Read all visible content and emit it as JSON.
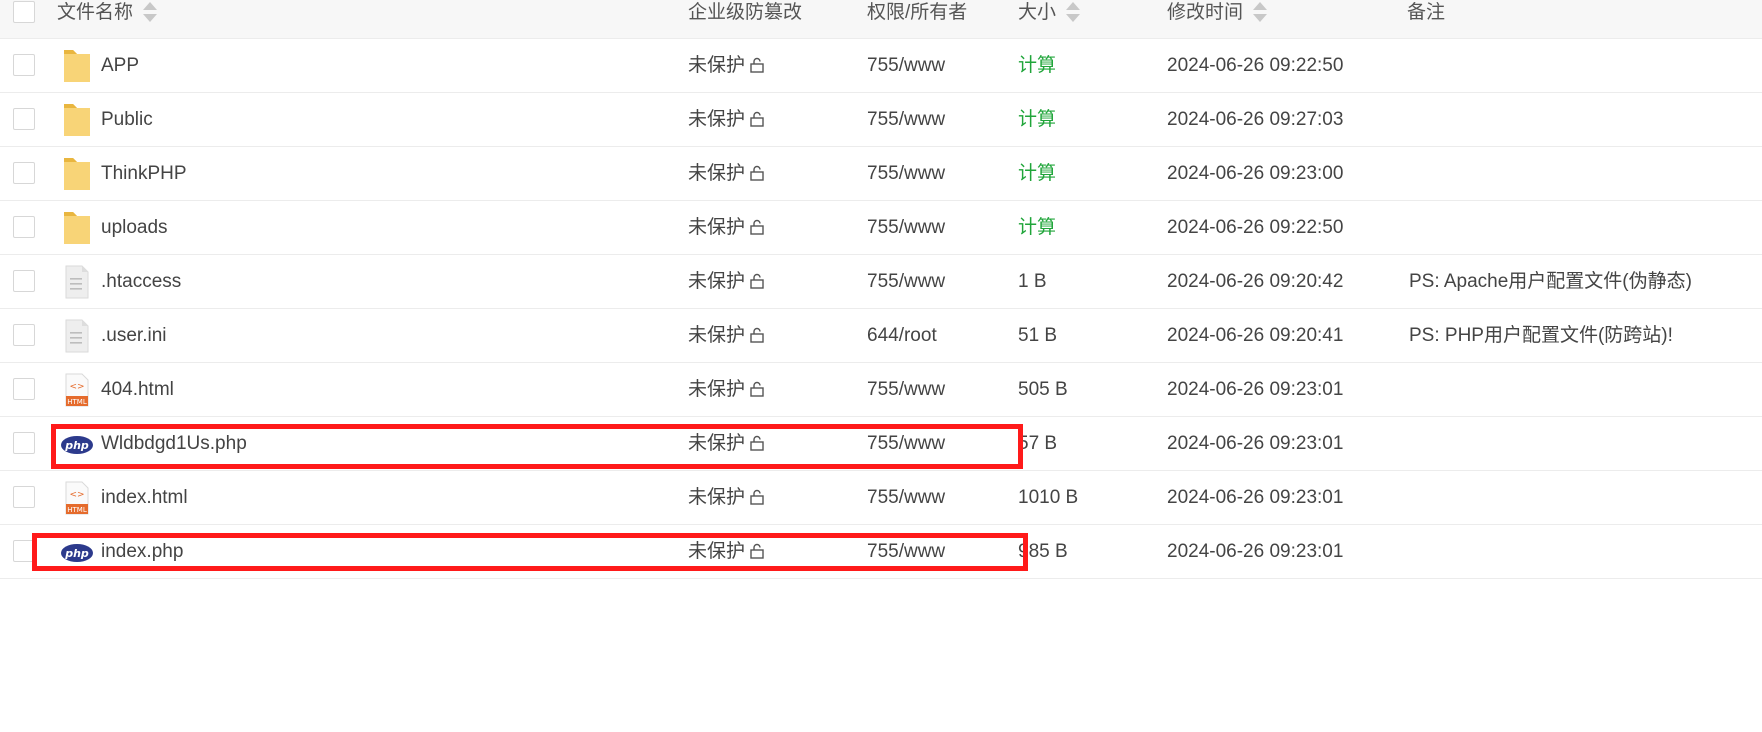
{
  "header": {
    "filename": "文件名称",
    "protection": "企业级防篡改",
    "permission": "权限/所有者",
    "size": "大小",
    "modified": "修改时间",
    "note": "备注"
  },
  "rows": [
    {
      "type": "folder",
      "name": "APP",
      "protection": "未保护",
      "permission": "755/www",
      "size": "计算",
      "time": "2024-06-26 09:22:50",
      "note": ""
    },
    {
      "type": "folder",
      "name": "Public",
      "protection": "未保护",
      "permission": "755/www",
      "size": "计算",
      "time": "2024-06-26 09:27:03",
      "note": ""
    },
    {
      "type": "folder",
      "name": "ThinkPHP",
      "protection": "未保护",
      "permission": "755/www",
      "size": "计算",
      "time": "2024-06-26 09:23:00",
      "note": ""
    },
    {
      "type": "folder",
      "name": "uploads",
      "protection": "未保护",
      "permission": "755/www",
      "size": "计算",
      "time": "2024-06-26 09:22:50",
      "note": ""
    },
    {
      "type": "text",
      "name": ".htaccess",
      "protection": "未保护",
      "permission": "755/www",
      "size": "1 B",
      "time": "2024-06-26 09:20:42",
      "note": "PS: Apache用户配置文件(伪静态)"
    },
    {
      "type": "text",
      "name": ".user.ini",
      "protection": "未保护",
      "permission": "644/root",
      "size": "51 B",
      "time": "2024-06-26 09:20:41",
      "note": "PS: PHP用户配置文件(防跨站)!"
    },
    {
      "type": "html",
      "name": "404.html",
      "protection": "未保护",
      "permission": "755/www",
      "size": "505 B",
      "time": "2024-06-26 09:23:01",
      "note": ""
    },
    {
      "type": "php",
      "name": "Wldbdgd1Us.php",
      "protection": "未保护",
      "permission": "755/www",
      "size": "57 B",
      "time": "2024-06-26 09:23:01",
      "note": ""
    },
    {
      "type": "html",
      "name": "index.html",
      "protection": "未保护",
      "permission": "755/www",
      "size": "1010 B",
      "time": "2024-06-26 09:23:01",
      "note": ""
    },
    {
      "type": "php",
      "name": "index.php",
      "protection": "未保护",
      "permission": "755/www",
      "size": "985 B",
      "time": "2024-06-26 09:23:01",
      "note": ""
    }
  ],
  "icon_labels": {
    "html": "HTML",
    "php": "php"
  },
  "colors": {
    "calc_link": "#20a53a",
    "highlight": "#ff1a1a",
    "folder": "#f5c85c"
  }
}
